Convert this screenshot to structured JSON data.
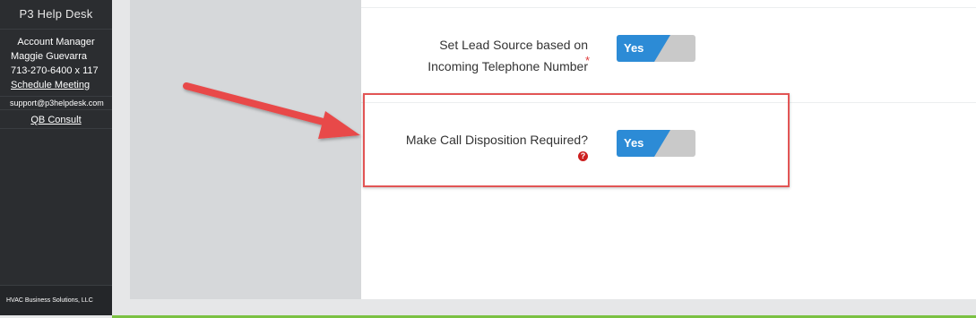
{
  "sidebar": {
    "brand": "P3 Help Desk",
    "account_title": "Account Manager",
    "manager_name": "Maggie Guevarra",
    "phone": "713-270-6400 x 117",
    "schedule_link": "Schedule Meeting",
    "support_email": "support@p3helpdesk.com",
    "qb_link": "QB Consult",
    "footer": "HVAC Business Solutions, LLC"
  },
  "settings": [
    {
      "label_line1": "Set Lead Source based on",
      "label_line2": "Incoming Telephone Number",
      "required_mark": "*",
      "toggle_value": "Yes"
    },
    {
      "label_line1": "Make Call Disposition Required?",
      "help_glyph": "?",
      "toggle_value": "Yes"
    }
  ],
  "colors": {
    "toggle_on": "#2c8bd6",
    "toggle_off": "#c9c9c9",
    "highlight": "#e25555",
    "accent_bar": "#7ac142"
  },
  "icons": {
    "help": "question-circle-icon",
    "annotation": "red-arrow-icon"
  }
}
